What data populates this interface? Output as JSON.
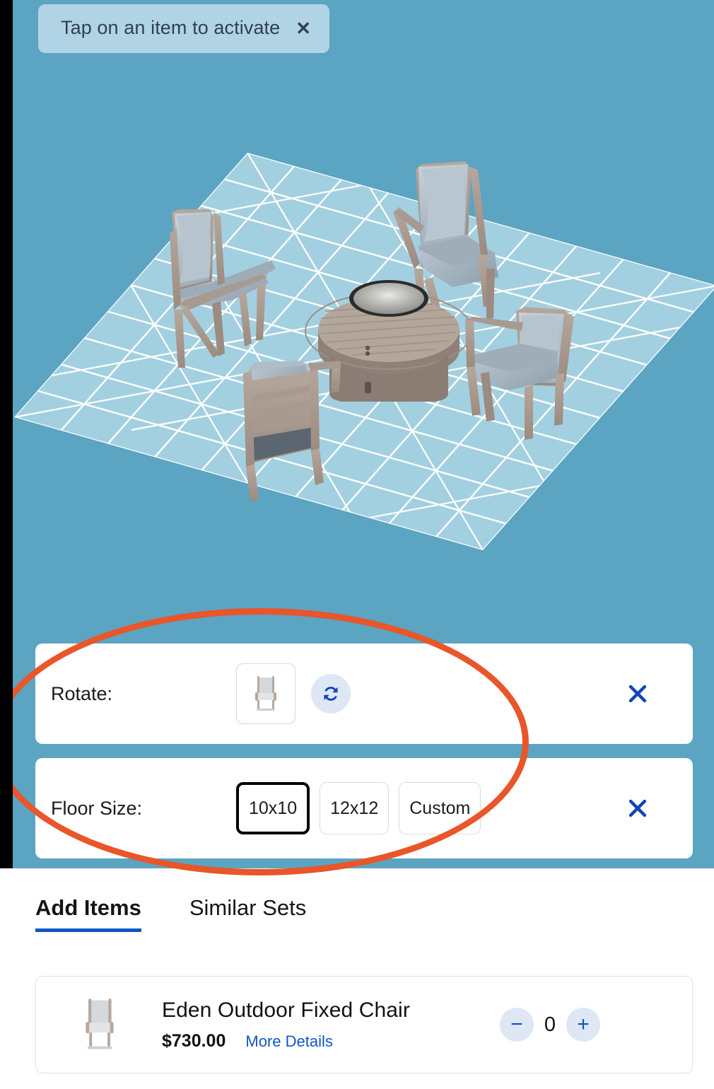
{
  "toast": {
    "message": "Tap on an item to activate",
    "close_icon": "close-icon"
  },
  "viewer": {
    "background_color": "#5ba4c2",
    "floor_color": "#a3d0e0",
    "grid_line_color": "#ffffff",
    "floor_size_label": "10x10",
    "items": [
      {
        "name": "Eden Outdoor Fixed Chair",
        "position": "back-left"
      },
      {
        "name": "Eden Outdoor Fixed Chair",
        "position": "back-right"
      },
      {
        "name": "Eden Outdoor Fixed Chair",
        "position": "front-left"
      },
      {
        "name": "Eden Outdoor Fixed Chair",
        "position": "front-right"
      },
      {
        "name": "Round Fire Pit Table",
        "position": "center"
      }
    ]
  },
  "highlight": {
    "color": "#e8562a",
    "shape": "ellipse"
  },
  "controls": {
    "rotate": {
      "label": "Rotate:",
      "thumb_alt": "chair-thumbnail",
      "rotate_icon": "rotate-icon",
      "close_icon": "close-icon"
    },
    "floor_size": {
      "label": "Floor Size:",
      "options": [
        {
          "label": "10x10",
          "selected": true
        },
        {
          "label": "12x12",
          "selected": false
        },
        {
          "label": "Custom",
          "selected": false
        }
      ],
      "close_icon": "close-icon"
    }
  },
  "sheet": {
    "tabs": [
      {
        "label": "Add Items",
        "active": true
      },
      {
        "label": "Similar Sets",
        "active": false
      }
    ],
    "accent_color": "#1155c4",
    "products": [
      {
        "title": "Eden Outdoor Fixed Chair",
        "price": "$730.00",
        "details_link": "More Details",
        "quantity": "0",
        "decrement_label": "−",
        "increment_label": "+",
        "thumb_alt": "chair-thumbnail"
      }
    ]
  }
}
